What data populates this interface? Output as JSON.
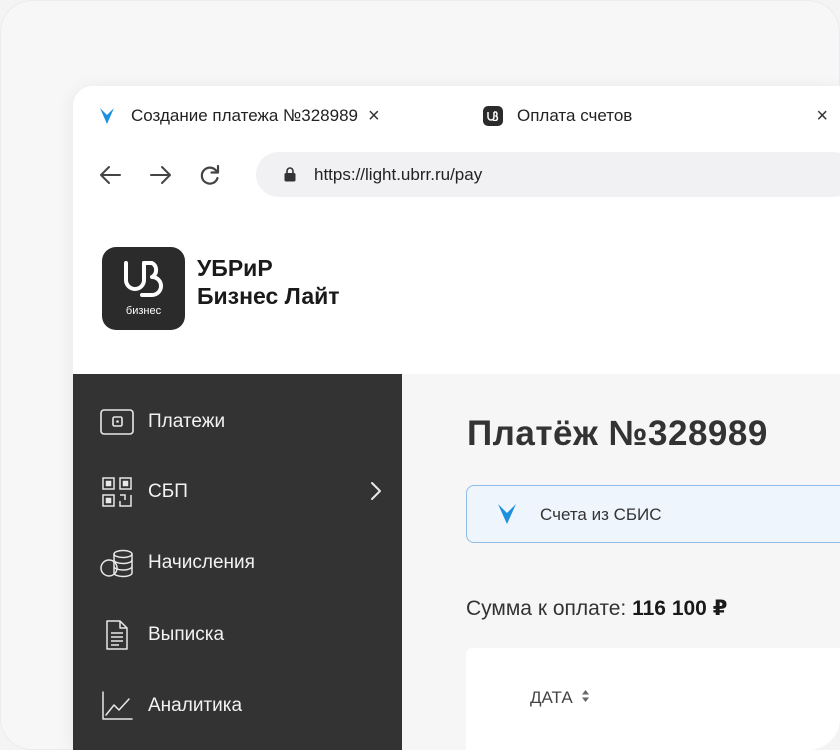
{
  "browser": {
    "tabs": [
      {
        "label": "Создание платежа №328989",
        "close": "×"
      },
      {
        "label": "Оплата счетов",
        "close": "×"
      }
    ],
    "url": "https://light.ubrr.ru/pay"
  },
  "app": {
    "logo_caption": "бизнес",
    "brand_line1": "УБРиР",
    "brand_line2": "Бизнес Лайт"
  },
  "sidebar": {
    "items": [
      {
        "label": "Платежи",
        "icon": "wallet-icon"
      },
      {
        "label": "СБП",
        "icon": "qr-code-icon"
      },
      {
        "label": "Начисления",
        "icon": "coins-icon"
      },
      {
        "label": "Выписка",
        "icon": "document-icon"
      },
      {
        "label": "Аналитика",
        "icon": "chart-line-icon"
      }
    ]
  },
  "main": {
    "title": "Платёж №328989",
    "sbis_label": "Счета из СБИС",
    "sum_label": "Сумма к оплате:",
    "sum_value": "116 100 ₽",
    "table_header_date": "ДАТА"
  },
  "colors": {
    "accent_blue": "#1b8fe0",
    "sidebar_bg": "#333333",
    "logo_bg": "#2b2b2b"
  }
}
